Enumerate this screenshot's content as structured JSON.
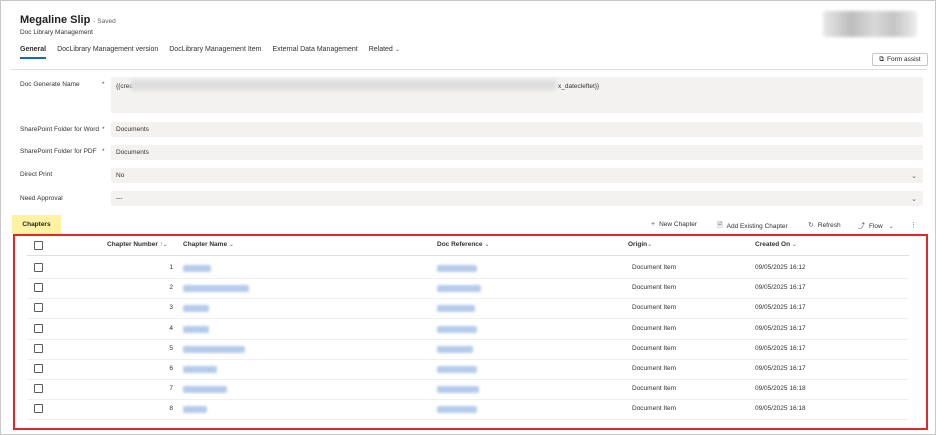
{
  "header": {
    "title": "Megaline Slip",
    "saved": "- Saved",
    "subtitle": "Doc Library Management"
  },
  "tabs": [
    {
      "label": "General",
      "active": true
    },
    {
      "label": "DocLibrary Management version",
      "active": false
    },
    {
      "label": "DocLibrary Management Item",
      "active": false
    },
    {
      "label": "External Data Management",
      "active": false
    },
    {
      "label": "Related",
      "active": false
    }
  ],
  "form_assist_label": "Form assist",
  "fields": {
    "doc_generate_name": {
      "label": "Doc Generate Name",
      "value_start": "{{crec",
      "value_end": "x_datecleftet}}"
    },
    "sharepoint_word": {
      "label": "SharePoint Folder for Word",
      "value": "Documents"
    },
    "sharepoint_pdf": {
      "label": "SharePoint Folder for PDF",
      "value": "Documents"
    },
    "direct_print": {
      "label": "Direct Print",
      "value": "No"
    },
    "need_approval": {
      "label": "Need Approval",
      "value": "---"
    }
  },
  "chapters": {
    "section_label": "Chapters",
    "commands": {
      "new": "New Chapter",
      "add_existing": "Add Existing Chapter",
      "refresh": "Refresh",
      "flow": "Flow"
    },
    "columns": {
      "chapter_number": "Chapter Number",
      "chapter_name": "Chapter Name",
      "doc_reference": "Doc Reference",
      "origin": "Origin",
      "created_on": "Created On"
    },
    "rows": [
      {
        "number": "1",
        "origin": "Document Item",
        "created": "09/05/2025 16:12"
      },
      {
        "number": "2",
        "origin": "Document Item",
        "created": "09/05/2025 16:17"
      },
      {
        "number": "3",
        "origin": "Document Item",
        "created": "09/05/2025 16:17"
      },
      {
        "number": "4",
        "origin": "Document Item",
        "created": "09/05/2025 16:17"
      },
      {
        "number": "5",
        "origin": "Document Item",
        "created": "09/05/2025 16:17"
      },
      {
        "number": "6",
        "origin": "Document Item",
        "created": "09/05/2025 16:17"
      },
      {
        "number": "7",
        "origin": "Document Item",
        "created": "09/05/2025 16:18"
      },
      {
        "number": "8",
        "origin": "Document Item",
        "created": "09/05/2025 16:18"
      }
    ]
  },
  "colors": {
    "accent": "#0f6cbd",
    "highlight": "#fff3a3",
    "grid_border": "#e0262e",
    "required": "#a4262c"
  }
}
